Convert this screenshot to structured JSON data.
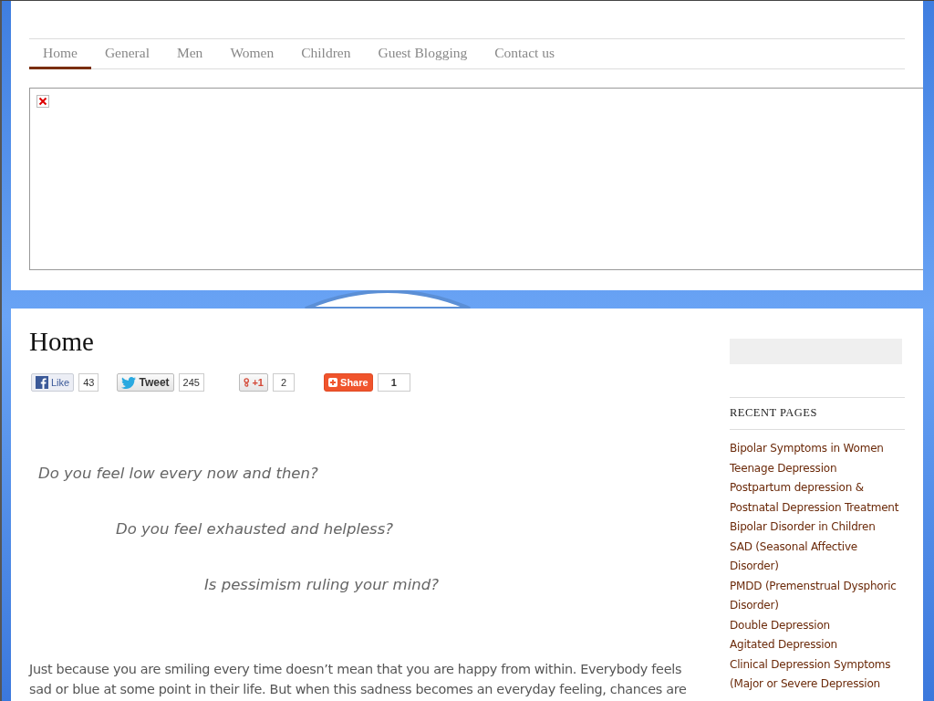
{
  "nav": {
    "tabs": [
      {
        "label": "Home",
        "selected": true
      },
      {
        "label": "General",
        "selected": false
      },
      {
        "label": "Men",
        "selected": false
      },
      {
        "label": "Women",
        "selected": false
      },
      {
        "label": "Children",
        "selected": false
      },
      {
        "label": "Guest Blogging",
        "selected": false
      },
      {
        "label": "Contact us",
        "selected": false
      }
    ]
  },
  "banner": {
    "kind": "broken-image"
  },
  "page_title": "Home",
  "social": [
    {
      "kind": "facebook",
      "label": "Like",
      "count": "43"
    },
    {
      "kind": "twitter",
      "label": "Tweet",
      "count": "245"
    },
    {
      "kind": "google",
      "label": "+1",
      "count": "2"
    },
    {
      "kind": "share",
      "label": "Share",
      "count": "1"
    }
  ],
  "quotes": [
    "Do you feel low every now and then?",
    "Do you feel exhausted and helpless?",
    "Is pessimism ruling your mind?"
  ],
  "body": "Just because you are smiling every time doesn’t mean that you are happy from within. Everybody feels sad or blue at some point in their life. But when this sadness becomes an everyday feeling, chances are",
  "sidebar": {
    "recent_pages": {
      "title": "RECENT PAGES",
      "items": [
        "Bipolar Symptoms in Women",
        "Teenage Depression",
        "Postpartum depression & Postnatal Depression Treatment",
        "Bipolar Disorder in Children",
        "SAD (Seasonal Affective Disorder)",
        "PMDD (Premenstrual Dysphoric Disorder)",
        "Double Depression",
        "Agitated Depression",
        "Clinical Depression Symptoms",
        "(Major or Severe Depression"
      ]
    }
  }
}
